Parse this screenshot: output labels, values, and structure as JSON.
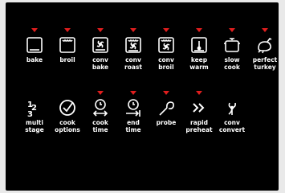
{
  "panel": {
    "row1": [
      {
        "label": "bake",
        "icon": "bake-icon",
        "indicator": true
      },
      {
        "label": "broil",
        "icon": "broil-icon",
        "indicator": true
      },
      {
        "label": "conv\nbake",
        "icon": "conv-bake-icon",
        "indicator": true
      },
      {
        "label": "conv\nroast",
        "icon": "conv-roast-icon",
        "indicator": true
      },
      {
        "label": "conv\nbroil",
        "icon": "conv-broil-icon",
        "indicator": true
      },
      {
        "label": "keep\nwarm",
        "icon": "keep-warm-icon",
        "indicator": true
      },
      {
        "label": "slow\ncook",
        "icon": "slow-cook-icon",
        "indicator": true
      },
      {
        "label": "perfect\nturkey",
        "icon": "turkey-icon",
        "indicator": true
      }
    ],
    "row2": [
      {
        "label": "multi\nstage",
        "icon": "multi-stage-icon",
        "indicator": false
      },
      {
        "label": "cook\noptions",
        "icon": "checkmark-icon",
        "indicator": false
      },
      {
        "label": "cook\ntime",
        "icon": "cook-time-icon",
        "indicator": true
      },
      {
        "label": "end\ntime",
        "icon": "end-time-icon",
        "indicator": true
      },
      {
        "label": "probe",
        "icon": "probe-icon",
        "indicator": true
      },
      {
        "label": "rapid\npreheat",
        "icon": "rapid-preheat-icon",
        "indicator": true
      },
      {
        "label": "conv\nconvert",
        "icon": "conv-convert-icon",
        "indicator": false
      }
    ]
  },
  "colors": {
    "indicator": "#e01e1e",
    "background": "#000000",
    "text": "#ffffff"
  }
}
